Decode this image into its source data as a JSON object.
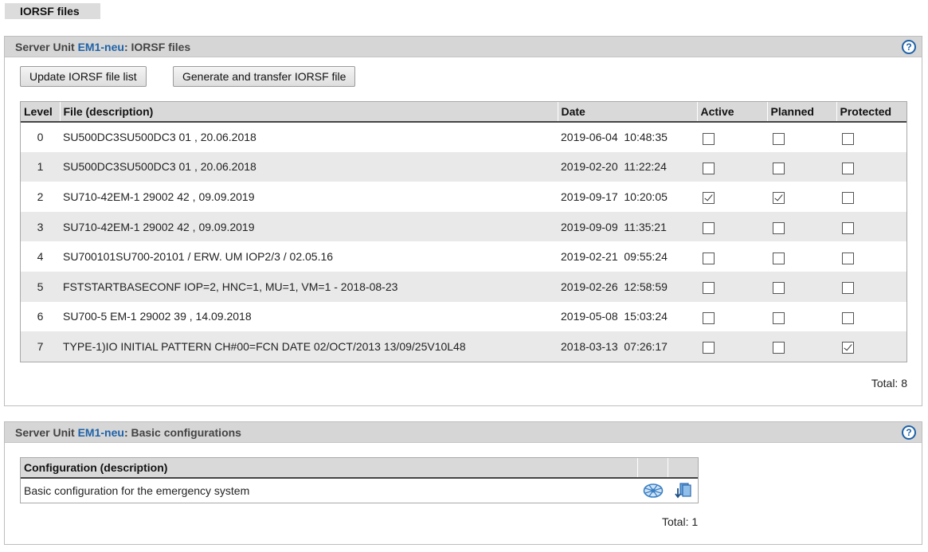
{
  "top_tab": {
    "label": "IORSF files"
  },
  "iorsf_panel": {
    "title_prefix": "Server Unit ",
    "unit_link": "EM1-neu",
    "title_suffix": ": IORSF files",
    "help_icon": "?",
    "buttons": {
      "update": "Update IORSF file list",
      "generate": "Generate and transfer IORSF file"
    },
    "columns": [
      "Level",
      "File (description)",
      "Date",
      "Active",
      "Planned",
      "Protected"
    ],
    "rows": [
      {
        "level": "0",
        "file": "SU500DC3SU500DC3 01 , 20.06.2018",
        "date": "2019-06-04  10:48:35",
        "active": false,
        "planned": false,
        "protected": false
      },
      {
        "level": "1",
        "file": "SU500DC3SU500DC3 01 , 20.06.2018",
        "date": "2019-02-20  11:22:24",
        "active": false,
        "planned": false,
        "protected": false
      },
      {
        "level": "2",
        "file": "SU710-42EM-1 29002 42 , 09.09.2019",
        "date": "2019-09-17  10:20:05",
        "active": true,
        "planned": true,
        "protected": false
      },
      {
        "level": "3",
        "file": "SU710-42EM-1 29002 42 , 09.09.2019",
        "date": "2019-09-09  11:35:21",
        "active": false,
        "planned": false,
        "protected": false
      },
      {
        "level": "4",
        "file": "SU700101SU700-20101 / ERW. UM IOP2/3 / 02.05.16",
        "date": "2019-02-21  09:55:24",
        "active": false,
        "planned": false,
        "protected": false
      },
      {
        "level": "5",
        "file": "FSTSTARTBASECONF IOP=2, HNC=1, MU=1, VM=1 - 2018-08-23",
        "date": "2019-02-26  12:58:59",
        "active": false,
        "planned": false,
        "protected": false
      },
      {
        "level": "6",
        "file": "SU700-5 EM-1 29002 39 , 14.09.2018",
        "date": "2019-05-08  15:03:24",
        "active": false,
        "planned": false,
        "protected": false
      },
      {
        "level": "7",
        "file": "TYPE-1)IO INITIAL PATTERN CH#00=FCN DATE 02/OCT/2013 13/09/25V10L48",
        "date": "2018-03-13  07:26:17",
        "active": false,
        "planned": false,
        "protected": true
      }
    ],
    "total": "Total: 8"
  },
  "basic_panel": {
    "title_prefix": "Server Unit ",
    "unit_link": "EM1-neu",
    "title_suffix": ": Basic configurations",
    "help_icon": "?",
    "columns": [
      "Configuration (description)",
      "",
      ""
    ],
    "rows": [
      {
        "description": "Basic configuration for the emergency system",
        "icons": [
          "network-config-icon",
          "download-transfer-icon"
        ]
      }
    ],
    "total": "Total: 1"
  },
  "colors": {
    "link": "#1f62a8",
    "header_bg": "#d6d6d6",
    "row_alt": "#e9e9e9",
    "icon_blue": "#3a7fc4"
  }
}
